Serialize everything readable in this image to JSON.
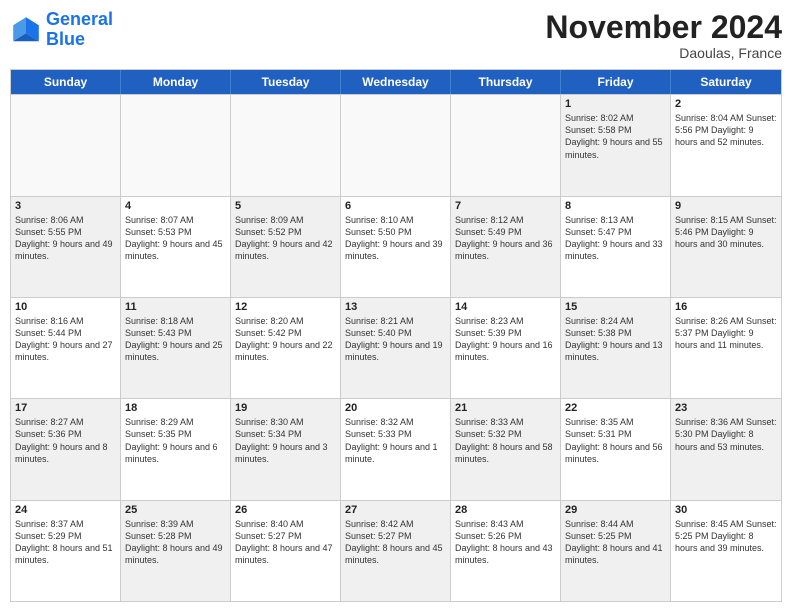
{
  "logo": {
    "line1": "General",
    "line2": "Blue"
  },
  "title": "November 2024",
  "location": "Daoulas, France",
  "days_of_week": [
    "Sunday",
    "Monday",
    "Tuesday",
    "Wednesday",
    "Thursday",
    "Friday",
    "Saturday"
  ],
  "weeks": [
    [
      {
        "day": "",
        "info": "",
        "empty": true
      },
      {
        "day": "",
        "info": "",
        "empty": true
      },
      {
        "day": "",
        "info": "",
        "empty": true
      },
      {
        "day": "",
        "info": "",
        "empty": true
      },
      {
        "day": "",
        "info": "",
        "empty": true
      },
      {
        "day": "1",
        "info": "Sunrise: 8:02 AM\nSunset: 5:58 PM\nDaylight: 9 hours and 55 minutes.",
        "shaded": true
      },
      {
        "day": "2",
        "info": "Sunrise: 8:04 AM\nSunset: 5:56 PM\nDaylight: 9 hours and 52 minutes.",
        "shaded": false
      }
    ],
    [
      {
        "day": "3",
        "info": "Sunrise: 8:06 AM\nSunset: 5:55 PM\nDaylight: 9 hours and 49 minutes.",
        "shaded": true
      },
      {
        "day": "4",
        "info": "Sunrise: 8:07 AM\nSunset: 5:53 PM\nDaylight: 9 hours and 45 minutes.",
        "shaded": false
      },
      {
        "day": "5",
        "info": "Sunrise: 8:09 AM\nSunset: 5:52 PM\nDaylight: 9 hours and 42 minutes.",
        "shaded": true
      },
      {
        "day": "6",
        "info": "Sunrise: 8:10 AM\nSunset: 5:50 PM\nDaylight: 9 hours and 39 minutes.",
        "shaded": false
      },
      {
        "day": "7",
        "info": "Sunrise: 8:12 AM\nSunset: 5:49 PM\nDaylight: 9 hours and 36 minutes.",
        "shaded": true
      },
      {
        "day": "8",
        "info": "Sunrise: 8:13 AM\nSunset: 5:47 PM\nDaylight: 9 hours and 33 minutes.",
        "shaded": false
      },
      {
        "day": "9",
        "info": "Sunrise: 8:15 AM\nSunset: 5:46 PM\nDaylight: 9 hours and 30 minutes.",
        "shaded": true
      }
    ],
    [
      {
        "day": "10",
        "info": "Sunrise: 8:16 AM\nSunset: 5:44 PM\nDaylight: 9 hours and 27 minutes.",
        "shaded": false
      },
      {
        "day": "11",
        "info": "Sunrise: 8:18 AM\nSunset: 5:43 PM\nDaylight: 9 hours and 25 minutes.",
        "shaded": true
      },
      {
        "day": "12",
        "info": "Sunrise: 8:20 AM\nSunset: 5:42 PM\nDaylight: 9 hours and 22 minutes.",
        "shaded": false
      },
      {
        "day": "13",
        "info": "Sunrise: 8:21 AM\nSunset: 5:40 PM\nDaylight: 9 hours and 19 minutes.",
        "shaded": true
      },
      {
        "day": "14",
        "info": "Sunrise: 8:23 AM\nSunset: 5:39 PM\nDaylight: 9 hours and 16 minutes.",
        "shaded": false
      },
      {
        "day": "15",
        "info": "Sunrise: 8:24 AM\nSunset: 5:38 PM\nDaylight: 9 hours and 13 minutes.",
        "shaded": true
      },
      {
        "day": "16",
        "info": "Sunrise: 8:26 AM\nSunset: 5:37 PM\nDaylight: 9 hours and 11 minutes.",
        "shaded": false
      }
    ],
    [
      {
        "day": "17",
        "info": "Sunrise: 8:27 AM\nSunset: 5:36 PM\nDaylight: 9 hours and 8 minutes.",
        "shaded": true
      },
      {
        "day": "18",
        "info": "Sunrise: 8:29 AM\nSunset: 5:35 PM\nDaylight: 9 hours and 6 minutes.",
        "shaded": false
      },
      {
        "day": "19",
        "info": "Sunrise: 8:30 AM\nSunset: 5:34 PM\nDaylight: 9 hours and 3 minutes.",
        "shaded": true
      },
      {
        "day": "20",
        "info": "Sunrise: 8:32 AM\nSunset: 5:33 PM\nDaylight: 9 hours and 1 minute.",
        "shaded": false
      },
      {
        "day": "21",
        "info": "Sunrise: 8:33 AM\nSunset: 5:32 PM\nDaylight: 8 hours and 58 minutes.",
        "shaded": true
      },
      {
        "day": "22",
        "info": "Sunrise: 8:35 AM\nSunset: 5:31 PM\nDaylight: 8 hours and 56 minutes.",
        "shaded": false
      },
      {
        "day": "23",
        "info": "Sunrise: 8:36 AM\nSunset: 5:30 PM\nDaylight: 8 hours and 53 minutes.",
        "shaded": true
      }
    ],
    [
      {
        "day": "24",
        "info": "Sunrise: 8:37 AM\nSunset: 5:29 PM\nDaylight: 8 hours and 51 minutes.",
        "shaded": false
      },
      {
        "day": "25",
        "info": "Sunrise: 8:39 AM\nSunset: 5:28 PM\nDaylight: 8 hours and 49 minutes.",
        "shaded": true
      },
      {
        "day": "26",
        "info": "Sunrise: 8:40 AM\nSunset: 5:27 PM\nDaylight: 8 hours and 47 minutes.",
        "shaded": false
      },
      {
        "day": "27",
        "info": "Sunrise: 8:42 AM\nSunset: 5:27 PM\nDaylight: 8 hours and 45 minutes.",
        "shaded": true
      },
      {
        "day": "28",
        "info": "Sunrise: 8:43 AM\nSunset: 5:26 PM\nDaylight: 8 hours and 43 minutes.",
        "shaded": false
      },
      {
        "day": "29",
        "info": "Sunrise: 8:44 AM\nSunset: 5:25 PM\nDaylight: 8 hours and 41 minutes.",
        "shaded": true
      },
      {
        "day": "30",
        "info": "Sunrise: 8:45 AM\nSunset: 5:25 PM\nDaylight: 8 hours and 39 minutes.",
        "shaded": false
      }
    ]
  ]
}
